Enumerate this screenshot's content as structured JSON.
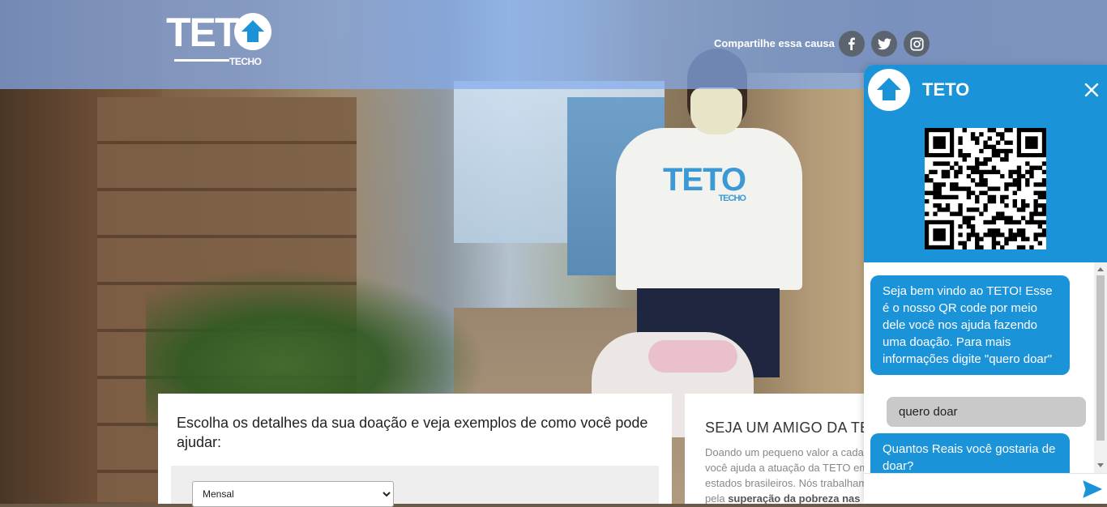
{
  "header": {
    "logo_text": "TETO",
    "logo_subtext": "TECHO",
    "share_label": "Compartilhe essa causa",
    "social": [
      {
        "icon": "facebook-icon",
        "glyph": "f"
      },
      {
        "icon": "twitter-icon",
        "glyph": ""
      },
      {
        "icon": "instagram-icon",
        "glyph": ""
      }
    ]
  },
  "hero": {
    "shirt_logo": "TETO",
    "shirt_sub": "TECHO"
  },
  "donation": {
    "title": "Escolha os detalhes da sua doação e veja exemplos de como você pode ajudar:",
    "frequency_selected": "Mensal"
  },
  "friend": {
    "title": "SEJA UM AMIGO DA TETO",
    "text_lines": [
      "Doando um pequeno valor a cada mês,",
      "você ajuda a atuação da TETO em",
      "estados brasileiros. Nós trabalhamos"
    ],
    "text_prefix": "pela",
    "text_bold": "superação da pobreza nas"
  },
  "chat": {
    "title": "TETO",
    "messages": [
      {
        "from": "bot",
        "text": "Seja bem vindo ao TETO! Esse é o nosso QR code por meio dele você nos ajuda fazendo uma doação. Para mais informações digite \"quero doar\""
      },
      {
        "from": "user",
        "text": "quero doar"
      },
      {
        "from": "bot",
        "text": "Quantos Reais você gostaria de doar?"
      }
    ],
    "input_value": "",
    "colors": {
      "accent": "#1b93d9",
      "user_bubble": "#c9c9c9"
    }
  }
}
